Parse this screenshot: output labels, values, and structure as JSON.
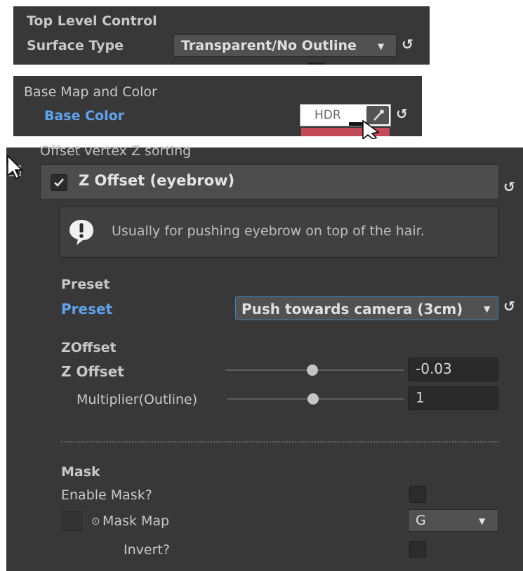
{
  "top_panel": {
    "header": "Top Level Control",
    "surface_type_label": "Surface Type",
    "surface_type_value": "Transparent/No Outline"
  },
  "base_panel": {
    "header": "Base Map and Color",
    "base_color_label": "Base Color",
    "hdr_label": "HDR"
  },
  "main": {
    "section_title": "Offset vertex Z sorting",
    "toggle_label": "Z Offset (eyebrow)",
    "toggle_checked": true,
    "info_text": "Usually for pushing eyebrow on top of the hair.",
    "preset_header": "Preset",
    "preset_label": "Preset",
    "preset_value": "Push towards camera (3cm)",
    "zoffset_header": "ZOffset",
    "zoffset_label": "Z Offset",
    "zoffset_value": "-0.03",
    "multiplier_label": "Multiplier(Outline)",
    "multiplier_value": "1",
    "mask_header": "Mask",
    "enable_mask_label": "Enable Mask?",
    "mask_map_label": "Mask Map",
    "mask_channel_value": "G",
    "invert_label": "Invert?"
  },
  "icons": {
    "reset": "↺",
    "dropdown_arrow": "▼",
    "eyedropper": "eyedropper-icon",
    "info": "exclamation-icon",
    "object_picker": "⊙"
  },
  "colors": {
    "panel_bg": "#383838",
    "label_blue": "#5fa3f1"
  }
}
